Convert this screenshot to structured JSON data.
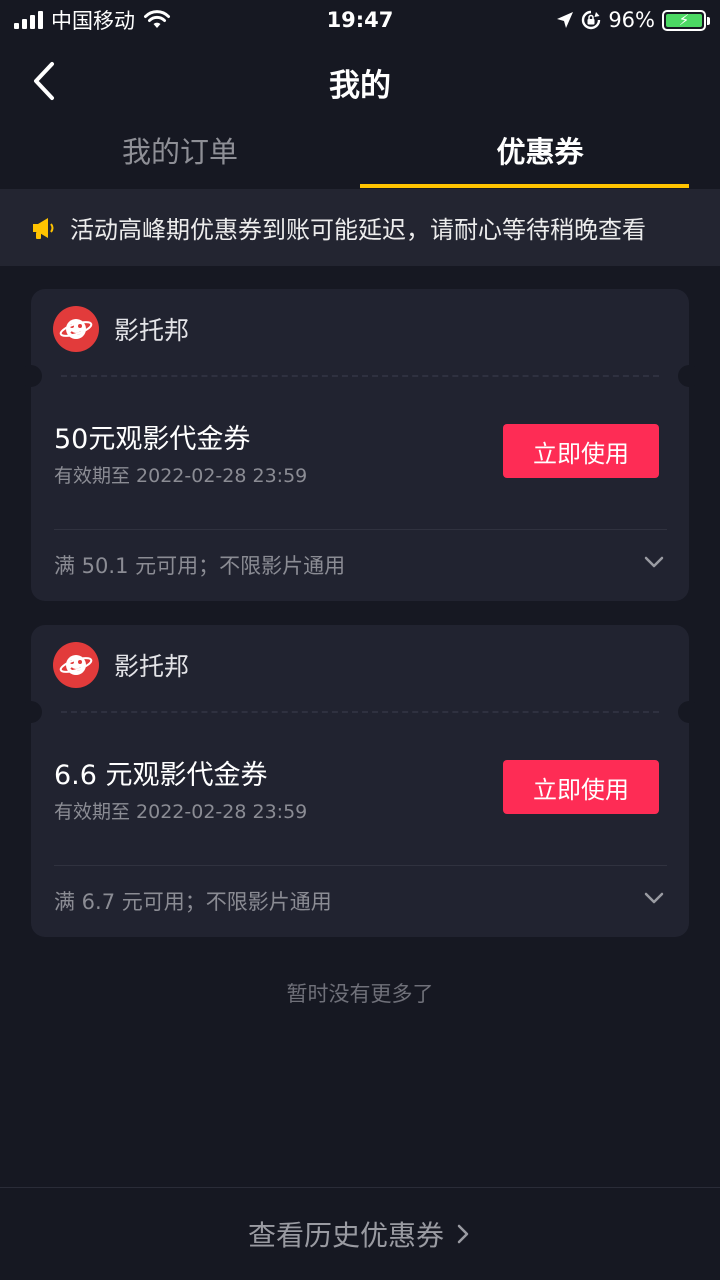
{
  "status_bar": {
    "carrier": "中国移动",
    "time": "19:47",
    "battery": "96%",
    "icons": [
      "signal-icon",
      "wifi-icon",
      "location-icon",
      "rotation-lock-icon",
      "battery-charging-icon"
    ]
  },
  "header": {
    "title": "我的",
    "back_icon": "chevron-left-icon"
  },
  "tabs": [
    {
      "label": "我的订单",
      "active": false
    },
    {
      "label": "优惠券",
      "active": true
    }
  ],
  "notice": {
    "icon": "megaphone-icon",
    "text": "活动高峰期优惠券到账可能延迟，请耐心等待稍晚查看"
  },
  "coupons": [
    {
      "merchant": "影托邦",
      "title": "50元观影代金券",
      "validity": "有效期至 2022-02-28 23:59",
      "button": "立即使用",
      "condition": "满 50.1 元可用；不限影片通用"
    },
    {
      "merchant": "影托邦",
      "title": "6.6 元观影代金券",
      "validity": "有效期至 2022-02-28 23:59",
      "button": "立即使用",
      "condition": "满 6.7 元可用；不限影片通用"
    }
  ],
  "footer_note": "暂时没有更多了",
  "bottom": {
    "label": "查看历史优惠券",
    "icon": "chevron-right-icon"
  },
  "colors": {
    "background": "#161822",
    "card": "#212330",
    "accent_tab": "#ffc300",
    "button": "#fe2c55",
    "notice_icon": "#ffc300"
  }
}
